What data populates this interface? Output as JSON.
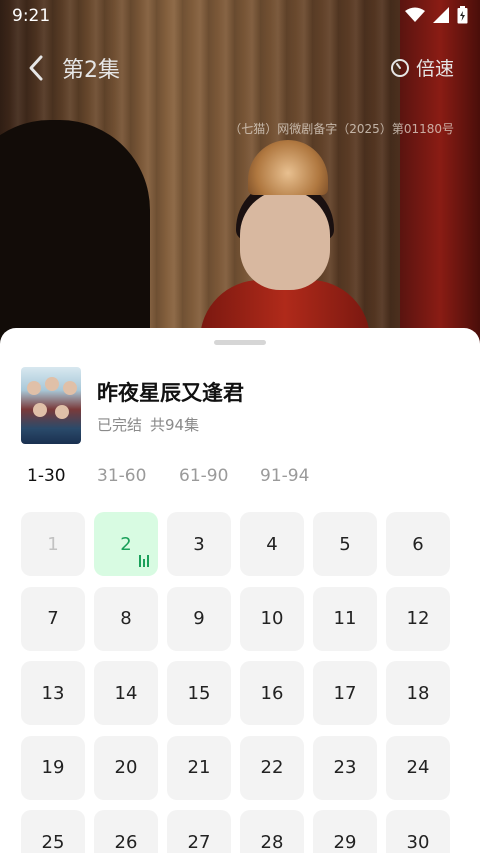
{
  "status_bar": {
    "time": "9:21"
  },
  "player": {
    "title": "第2集",
    "speed_label": "倍速",
    "license_text": "（七猫）网微剧备字（2025）第01180号"
  },
  "show": {
    "title": "昨夜星辰又逢君",
    "status": "已完结",
    "episode_count": "共94集"
  },
  "ranges": [
    "1-30",
    "31-60",
    "61-90",
    "91-94"
  ],
  "active_range": "1-30",
  "episodes": [
    "1",
    "2",
    "3",
    "4",
    "5",
    "6",
    "7",
    "8",
    "9",
    "10",
    "11",
    "12",
    "13",
    "14",
    "15",
    "16",
    "17",
    "18",
    "19",
    "20",
    "21",
    "22",
    "23",
    "24",
    "25",
    "26",
    "27",
    "28",
    "29",
    "30"
  ],
  "current_episode": "2",
  "watched_episodes": [
    "1"
  ],
  "colors": {
    "accent": "#1aa05a",
    "current_bg": "#d8fbe2",
    "tile_bg": "#f3f3f3"
  },
  "icons": [
    "back-arrow-icon",
    "speed-gauge-icon",
    "wifi-icon",
    "signal-icon",
    "battery-icon",
    "playing-indicator-icon"
  ]
}
